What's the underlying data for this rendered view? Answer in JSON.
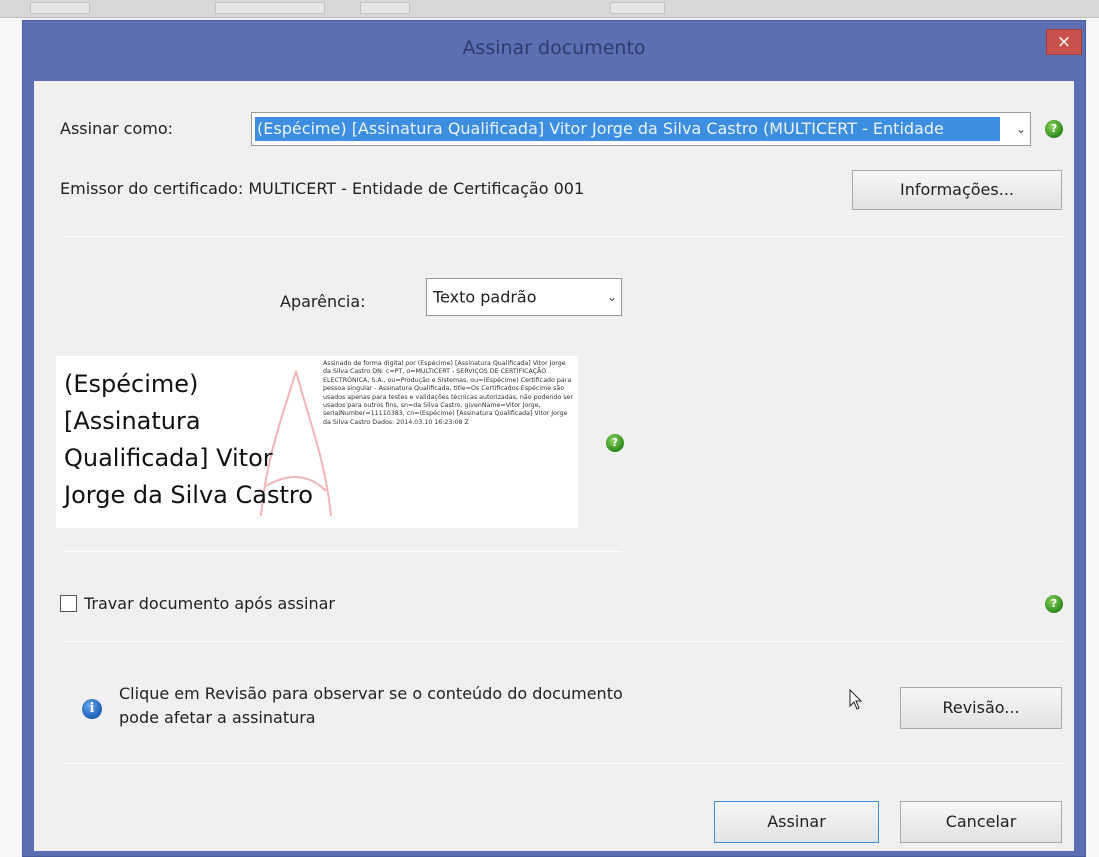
{
  "dialog": {
    "title": "Assinar documento",
    "close_label": "×"
  },
  "sign_as": {
    "label": "Assinar como:",
    "value": "(Espécime) [Assinatura Qualificada] Vitor Jorge da Silva Castro (MULTICERT - Entidade"
  },
  "issuer": {
    "text": "Emissor do certificado: MULTICERT - Entidade de Certificação 001",
    "info_button": "Informações..."
  },
  "appearance": {
    "label": "Aparência:",
    "value": "Texto padrão"
  },
  "preview": {
    "name_lines": [
      "(Espécime)",
      "[Assinatura",
      "Qualificada] Vitor",
      "Jorge da Silva Castro"
    ],
    "detail_text": "Assinado de forma digital por (Espécime) [Assinatura Qualificada] Vitor Jorge da Silva Castro DN: c=PT, o=MULTICERT - SERVIÇOS DE CERTIFICAÇÃO ELECTRÓNICA, S.A., ou=Produção e Sistemas, ou=(Espécime) Certificado para pessoa singular - Assinatura Qualificada, title=Os Certificados Espécime são usados apenas para testes e validações técnicas autorizadas, não podendo ser usados para outros fins, sn=da Silva Castro, givenName=Vitor Jorge, serialNumber=11110383, cn=(Espécime) [Assinatura Qualificada] Vitor Jorge da Silva Castro Dados: 2014.03.10 16:23:08 Z"
  },
  "lock": {
    "label": "Travar documento após assinar"
  },
  "review": {
    "message": [
      "Clique em Revisão para observar se o conteúdo do documento",
      "pode afetar a assinatura"
    ],
    "button": "Revisão..."
  },
  "actions": {
    "sign": "Assinar",
    "cancel": "Cancelar"
  },
  "icons": {
    "help": "help-icon",
    "info": "info-icon",
    "dropdown": "chevron-down-icon"
  },
  "colors": {
    "title_bar": "#5d6fb3",
    "selection": "#3d8ee0",
    "close": "#c9524e",
    "help": "#2d8a1a"
  }
}
